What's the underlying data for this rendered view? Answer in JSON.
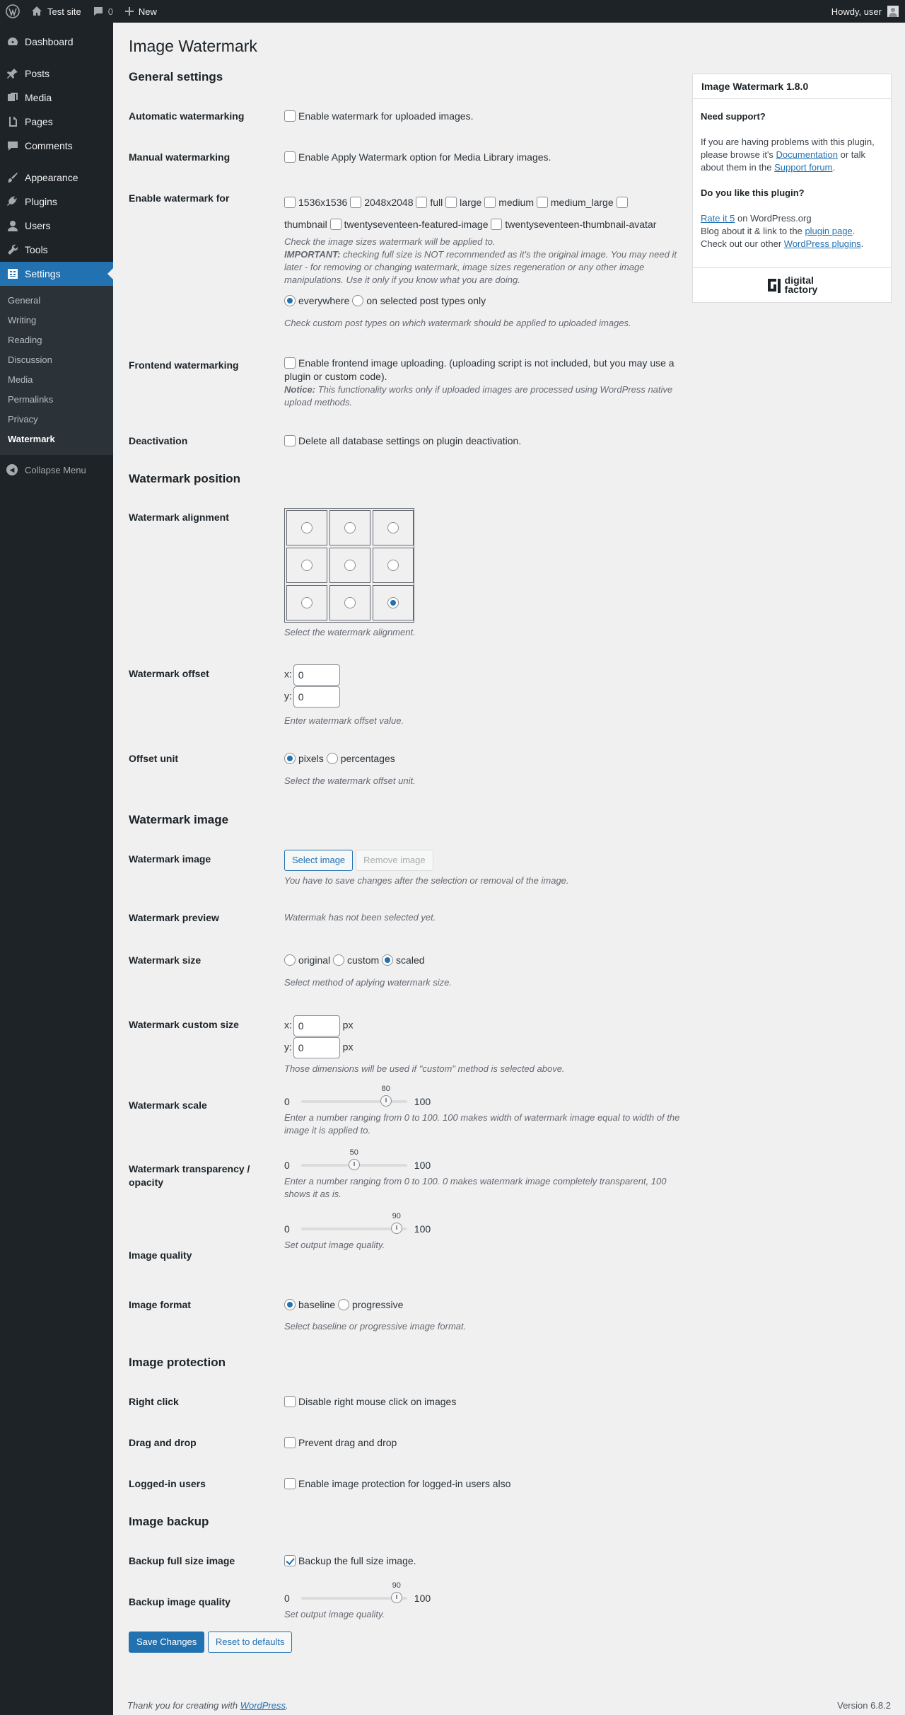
{
  "adminbar": {
    "site_name": "Test site",
    "comments_count": "0",
    "new_label": "New",
    "howdy": "Howdy, user"
  },
  "sidebar": {
    "items": [
      {
        "label": "Dashboard",
        "icon": "dashboard-icon"
      },
      {
        "label": "Posts",
        "icon": "pin-icon"
      },
      {
        "label": "Media",
        "icon": "media-icon"
      },
      {
        "label": "Pages",
        "icon": "page-icon"
      },
      {
        "label": "Comments",
        "icon": "comment-icon"
      },
      {
        "label": "Appearance",
        "icon": "brush-icon"
      },
      {
        "label": "Plugins",
        "icon": "plug-icon"
      },
      {
        "label": "Users",
        "icon": "user-icon"
      },
      {
        "label": "Tools",
        "icon": "wrench-icon"
      },
      {
        "label": "Settings",
        "icon": "settings-icon"
      }
    ],
    "submenu": [
      "General",
      "Writing",
      "Reading",
      "Discussion",
      "Media",
      "Permalinks",
      "Privacy",
      "Watermark"
    ],
    "collapse": "Collapse Menu"
  },
  "page": {
    "title": "Image Watermark"
  },
  "general": {
    "heading": "General settings",
    "auto_label": "Automatic watermarking",
    "auto_text": "Enable watermark for uploaded images.",
    "manual_label": "Manual watermarking",
    "manual_text": "Enable Apply Watermark option for Media Library images.",
    "enable_for_label": "Enable watermark for",
    "sizes": [
      "1536x1536",
      "2048x2048",
      "full",
      "large",
      "medium",
      "medium_large",
      "thumbnail",
      "twentyseventeen-featured-image",
      "twentyseventeen-thumbnail-avatar"
    ],
    "sizes_desc": "Check the image sizes watermark will be applied to.",
    "important_label": "IMPORTANT:",
    "important_text": " checking full size is NOT recommended as it's the original image. You may need it later - for removing or changing watermark, image sizes regeneration or any other image manipulations. Use it only if you know what you are doing.",
    "everywhere": "everywhere",
    "selected_types": "on selected post types only",
    "post_types_desc": "Check custom post types on which watermark should be applied to uploaded images.",
    "frontend_label": "Frontend watermarking",
    "frontend_text": "Enable frontend image uploading. (uploading script is not included, but you may use a plugin or custom code).",
    "notice_label": "Notice:",
    "notice_text": " This functionality works only if uploaded images are processed using WordPress native upload methods.",
    "deactivation_label": "Deactivation",
    "deactivation_text": "Delete all database settings on plugin deactivation."
  },
  "position": {
    "heading": "Watermark position",
    "alignment_label": "Watermark alignment",
    "alignment_selected": 8,
    "alignment_desc": "Select the watermark alignment.",
    "offset_label": "Watermark offset",
    "x_label": "x:",
    "y_label": "y:",
    "offset_x": "0",
    "offset_y": "0",
    "offset_desc": "Enter watermark offset value.",
    "unit_label": "Offset unit",
    "pixels": "pixels",
    "percentages": "percentages",
    "unit_desc": "Select the watermark offset unit."
  },
  "image": {
    "heading": "Watermark image",
    "image_label": "Watermark image",
    "select_button": "Select image",
    "remove_button": "Remove image",
    "image_desc": "You have to save changes after the selection or removal of the image.",
    "preview_label": "Watermark preview",
    "preview_text": "Watermak has not been selected yet.",
    "size_label": "Watermark size",
    "size_original": "original",
    "size_custom": "custom",
    "size_scaled": "scaled",
    "size_desc": "Select method of aplying watermark size.",
    "custom_size_label": "Watermark custom size",
    "custom_x": "0",
    "custom_y": "0",
    "px": "px",
    "custom_desc": "Those dimensions will be used if \"custom\" method is selected above.",
    "scale_label": "Watermark scale",
    "scale_value": 80,
    "scale_value_text": "80",
    "scale_desc": "Enter a number ranging from 0 to 100. 100 makes width of watermark image equal to width of the image it is applied to.",
    "opacity_label": "Watermark transparency / opacity",
    "opacity_value": 50,
    "opacity_value_text": "50",
    "opacity_desc": "Enter a number ranging from 0 to 100. 0 makes watermark image completely transparent, 100 shows it as is.",
    "quality_label": "Image quality",
    "quality_value": 90,
    "quality_value_text": "90",
    "quality_desc": "Set output image quality.",
    "format_label": "Image format",
    "baseline": "baseline",
    "progressive": "progressive",
    "format_desc": "Select baseline or progressive image format.",
    "min": "0",
    "max": "100"
  },
  "protection": {
    "heading": "Image protection",
    "right_click_label": "Right click",
    "right_click_text": "Disable right mouse click on images",
    "drag_label": "Drag and drop",
    "drag_text": "Prevent drag and drop",
    "loggedin_label": "Logged-in users",
    "loggedin_text": "Enable image protection for logged-in users also"
  },
  "backup": {
    "heading": "Image backup",
    "full_label": "Backup full size image",
    "full_text": "Backup the full size image.",
    "quality_label": "Backup image quality",
    "quality_value": 90,
    "quality_value_text": "90",
    "quality_desc": "Set output image quality."
  },
  "actions": {
    "save": "Save Changes",
    "reset": "Reset to defaults"
  },
  "sidebox": {
    "title": "Image Watermark 1.8.0",
    "support_heading": "Need support?",
    "support_pre": "If you are having problems with this plugin, please browse it's ",
    "documentation": "Documentation",
    "support_mid": " or talk about them in the ",
    "support_forum": "Support forum",
    "support_post": ".",
    "like_heading": "Do you like this plugin?",
    "rate": "Rate it 5",
    "rate_post": " on WordPress.org",
    "blog_pre": "Blog about it & link to the ",
    "plugin_page": "plugin page",
    "blog_post": ".",
    "checkout_pre": "Check out our other ",
    "wp_plugins": "WordPress plugins",
    "checkout_post": ".",
    "logo_line1": "digital",
    "logo_line2": "factory"
  },
  "footer": {
    "thanks_pre": "Thank you for creating with ",
    "wordpress": "WordPress",
    "thanks_post": ".",
    "version": "Version 6.8.2"
  }
}
